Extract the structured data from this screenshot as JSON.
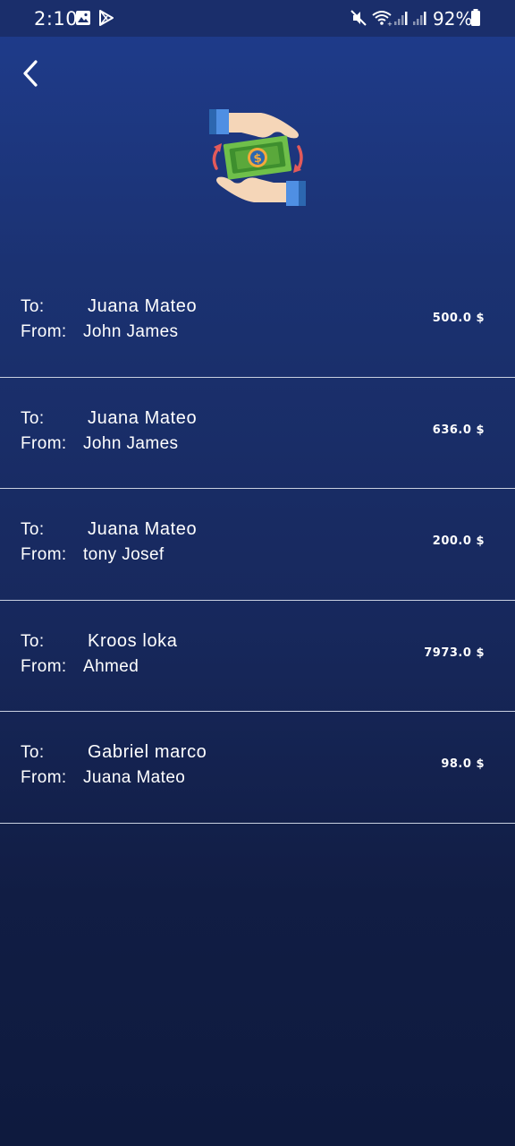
{
  "status_bar": {
    "time": "2:10",
    "battery": "92%",
    "icons": [
      "image-icon",
      "play-store-icon",
      "mute-icon",
      "wifi-icon",
      "signal-icon",
      "signal-icon",
      "battery-icon"
    ]
  },
  "header": {
    "back_icon": "chevron-left-icon",
    "hero_icon": "money-transfer-icon"
  },
  "labels": {
    "to": "To:",
    "from": "From:"
  },
  "transactions": [
    {
      "to": "Juana Mateo",
      "from": "John James",
      "amount": "500.0 $"
    },
    {
      "to": "Juana Mateo",
      "from": "John James",
      "amount": "636.0 $"
    },
    {
      "to": "Juana Mateo",
      "from": "tony Josef",
      "amount": "200.0 $"
    },
    {
      "to": "Kroos loka",
      "from": "Ahmed",
      "amount": "7973.0 $"
    },
    {
      "to": "Gabriel marco",
      "from": "Juana Mateo",
      "amount": "98.0 $"
    }
  ],
  "colors": {
    "background_top": "#1f3c8d",
    "background_bottom": "#0e1a3e",
    "divider": "#c9d0e0",
    "text": "#ffffff"
  }
}
